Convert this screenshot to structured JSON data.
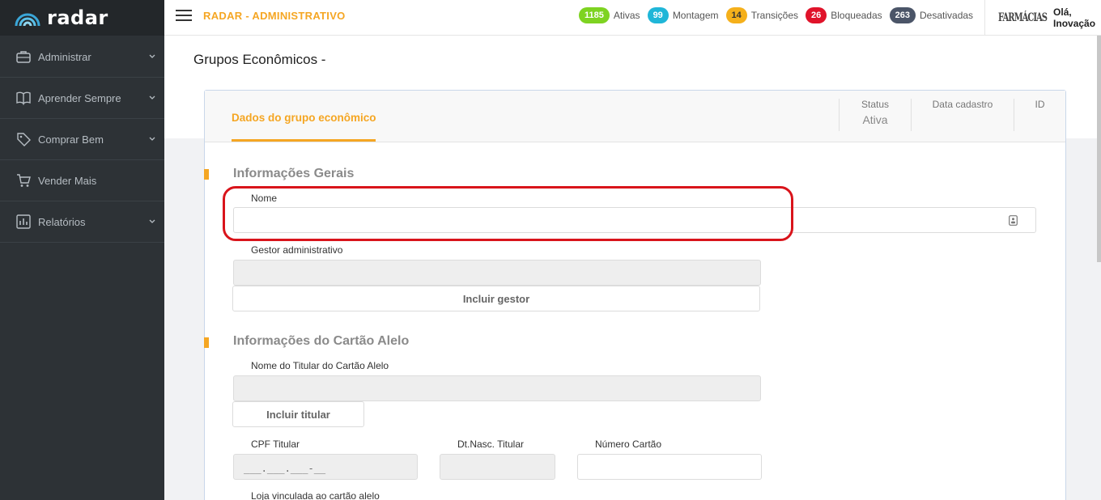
{
  "brand": {
    "name": "radar"
  },
  "sidebar": {
    "items": [
      {
        "label": "Administrar",
        "icon": "briefcase-icon",
        "has_submenu": true
      },
      {
        "label": "Aprender Sempre",
        "icon": "book-icon",
        "has_submenu": true
      },
      {
        "label": "Comprar Bem",
        "icon": "tag-icon",
        "has_submenu": true
      },
      {
        "label": "Vender Mais",
        "icon": "cart-icon",
        "has_submenu": false
      },
      {
        "label": "Relatórios",
        "icon": "bar-chart-icon",
        "has_submenu": true
      }
    ]
  },
  "topbar": {
    "title": "RADAR - ADMINISTRATIVO",
    "stats": [
      {
        "count": "1185",
        "label": "Ativas",
        "color": "#7ed321"
      },
      {
        "count": "99",
        "label": "Montagem",
        "color": "#1fb6d8"
      },
      {
        "count": "14",
        "label": "Transições",
        "color": "#f5b01b"
      },
      {
        "count": "26",
        "label": "Bloqueadas",
        "color": "#e0132a"
      },
      {
        "count": "263",
        "label": "Desativadas",
        "color": "#4b5568"
      }
    ],
    "user_logo_text": "FARMÁCIAS",
    "greeting": "Olá, Inovação"
  },
  "page": {
    "title": "Grupos Econômicos -",
    "tab_label": "Dados do grupo econômico",
    "header_cols": {
      "status_label": "Status",
      "status_value": "Ativa",
      "date_label": "Data cadastro",
      "date_value": "",
      "id_label": "ID",
      "id_value": ""
    },
    "section_general": "Informações Gerais",
    "nome_label": "Nome",
    "nome_value": "",
    "gestor_label": "Gestor administrativo",
    "gestor_value": "",
    "incluir_gestor": "Incluir gestor",
    "section_card": "Informações do Cartão Alelo",
    "titular_label": "Nome do Titular do Cartão Alelo",
    "titular_value": "",
    "incluir_titular": "Incluir titular",
    "cpf_label": "CPF Titular",
    "cpf_mask": "___.___.___-__",
    "dtnasc_label": "Dt.Nasc. Titular",
    "dtnasc_value": "",
    "numero_label": "Número Cartão",
    "numero_value": "",
    "loja_label": "Loja vinculada ao cartão alelo"
  },
  "colors": {
    "accent": "#f5a623",
    "sidebar": "#2d3236",
    "highlight": "#d9141b"
  }
}
